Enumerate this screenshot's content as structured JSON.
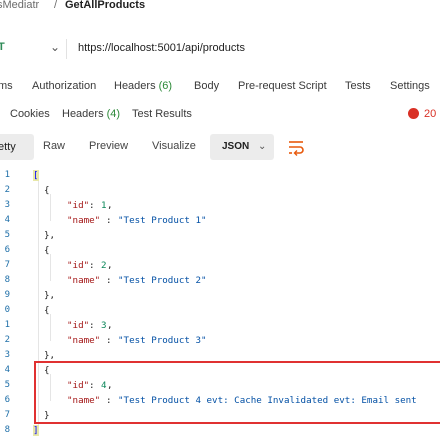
{
  "breadcrumb": {
    "collection": "sMediatr",
    "separator": "/",
    "request": "GetAllProducts"
  },
  "url_bar": {
    "method": "T",
    "url": "https://localhost:5001/api/products"
  },
  "request_tabs": {
    "params_tail": "ms",
    "authorization": "Authorization",
    "headers": "Headers",
    "headers_count": "(6)",
    "body": "Body",
    "prerequest": "Pre-request Script",
    "tests": "Tests",
    "settings": "Settings"
  },
  "response_tabs": {
    "cookies": "Cookies",
    "headers": "Headers",
    "headers_count": "(4)",
    "test_results": "Test Results",
    "status_partial": "20"
  },
  "view_bar": {
    "pretty": "etty",
    "raw": "Raw",
    "preview": "Preview",
    "visualize": "Visualize",
    "format": "JSON"
  },
  "code": {
    "line_numbers": [
      "1",
      "2",
      "3",
      "4",
      "5",
      "6",
      "7",
      "8",
      "9",
      "0",
      "1",
      "2",
      "3",
      "4",
      "5",
      "6",
      "7",
      "8"
    ],
    "open_bracket": "[",
    "close_bracket": "]",
    "open_brace": "{",
    "close_brace": "}",
    "close_brace_comma": "},",
    "id_key": "\"id\"",
    "name_key": "\"name\"",
    "colon": ": ",
    "comma": ",",
    "items": [
      {
        "id": "1",
        "name": "\"Test Product 1\""
      },
      {
        "id": "2",
        "name": "\"Test Product 2\""
      },
      {
        "id": "3",
        "name": "\"Test Product 3\""
      },
      {
        "id": "4",
        "name": "\"Test Product 4 evt: Cache Invalidated evt: Email sent"
      }
    ]
  },
  "colors": {
    "accent_green": "#2d8a39",
    "highlight_red": "#e03131",
    "string_blue": "#0451a5",
    "key_red": "#a31515",
    "number_green": "#098658"
  },
  "icons": {
    "wrap": "wrap-lines-icon",
    "globe": "no-environment-icon",
    "chevron": "chevron-down-icon"
  }
}
